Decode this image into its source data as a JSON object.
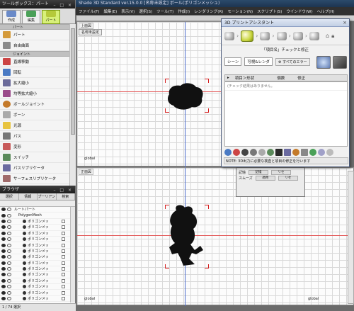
{
  "toolbox": {
    "title": "ツールボックス：パート",
    "tabs": [
      {
        "label": "作成",
        "color": "#6a8ac8"
      },
      {
        "label": "編集",
        "color": "#4aa058"
      },
      {
        "label": "パート",
        "color": "#d8f07a"
      }
    ],
    "section_part": "パート",
    "items_part": [
      "パート",
      "自由曲面"
    ],
    "section_joint": "ジョイント",
    "items_joint": [
      "直線移動",
      "回転",
      "拡大縮小",
      "均等拡大縮小",
      "ボールジョイント",
      "ボーン",
      "光源",
      "パス",
      "変形",
      "スイッチ",
      "パスリプリケータ",
      "サーフェスリプリケータ"
    ]
  },
  "browser": {
    "title": "ブラウザ",
    "tabs": [
      "選択",
      "情報",
      "プーリアン",
      "検索"
    ],
    "root_label": "ルートパート",
    "mesh_label": "PolygonMesh",
    "child_label": "ポリゴンメッ",
    "status": "1 / 74 選択"
  },
  "window": {
    "title": "Shade 3D Standard ver.15.0.0  [名称未設定]  ボール(ポリゴンメッシュ)",
    "menus": [
      "ファイル(F)",
      "編集(E)",
      "表示(V)",
      "選択(S)",
      "ツール(T)",
      "作成(I)",
      "レンダリング(R)",
      "モーション(N)",
      "スクリプト(S)",
      "ウインドウ(W)",
      "ヘルプ(H)"
    ]
  },
  "viewports": {
    "top": {
      "label": "上面図",
      "camera_select": "名称未設定",
      "axis_label": "global"
    },
    "bottom": {
      "label": "正面図",
      "axis_label": "global",
      "axis_label_right": "global"
    }
  },
  "assistant": {
    "title": "3D プリントアシスタント",
    "check_title": "「項目名」チェックと修正",
    "scene_select": "シーン",
    "view_select": "可視&レンダ",
    "check_all": "すべてのエラー",
    "col_item": "項目＞形状",
    "col_count": "個数",
    "col_fix": "修正",
    "hint": "(チェック結果はありません。",
    "note": "NOTE: 3D出力に必要な検査と項目の修正を行います"
  },
  "mini": {
    "row1_label": "記憶",
    "row1_btn1": "記憶",
    "row1_btn2": "リセ",
    "row2_label": "スムーズ",
    "row2_btn1": "適用",
    "row2_btn2": "リセ"
  }
}
